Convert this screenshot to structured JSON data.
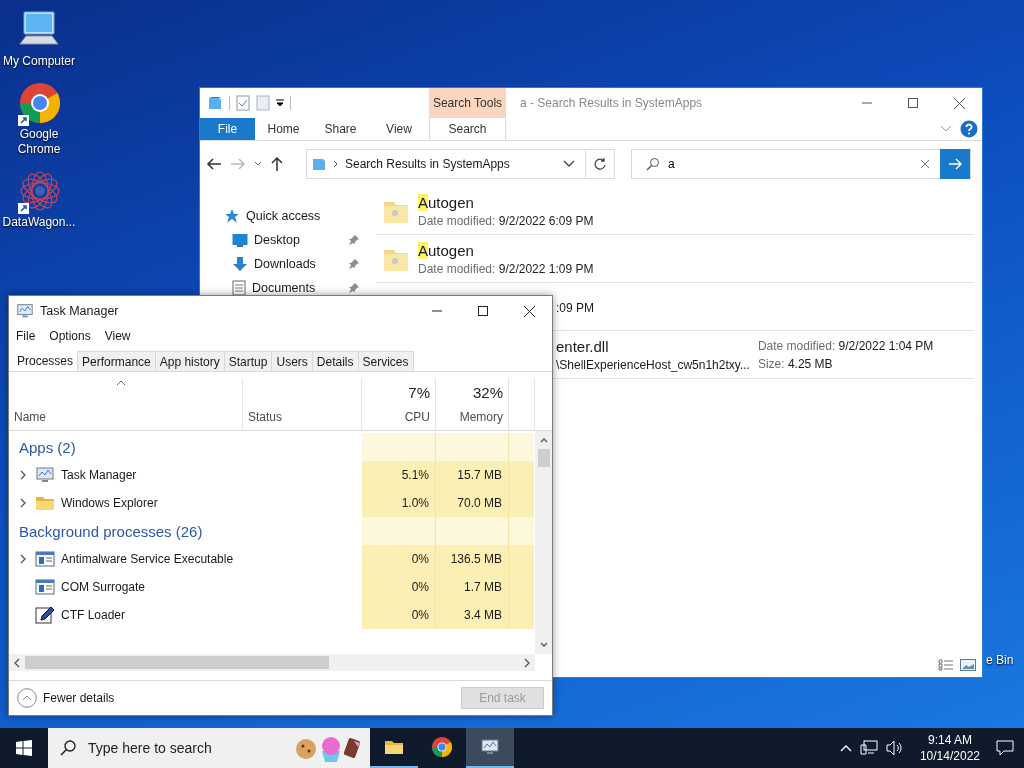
{
  "desktop_icons": [
    {
      "label": "My Computer",
      "kind": "computer"
    },
    {
      "label": "Google Chrome",
      "kind": "chrome"
    },
    {
      "label": "DataWagon...",
      "kind": "mandala"
    }
  ],
  "recycle_bin_label": "e Bin",
  "explorer": {
    "context_tab": "Search Tools",
    "title": "a - Search Results in SystemApps",
    "ribbon_tabs": [
      {
        "label": "File",
        "kind": "file"
      },
      {
        "label": "Home",
        "kind": "tab",
        "selected": false
      },
      {
        "label": "Share",
        "kind": "tab",
        "selected": false
      },
      {
        "label": "View",
        "kind": "tab",
        "selected": false
      },
      {
        "label": "Search",
        "kind": "tab",
        "selected": true
      }
    ],
    "address": "Search Results in SystemApps",
    "search": {
      "value": "a"
    },
    "nav_items": [
      {
        "label": "Quick access",
        "kind": "star",
        "pinned": false
      },
      {
        "label": "Desktop",
        "kind": "desktop",
        "pinned": true
      },
      {
        "label": "Downloads",
        "kind": "download",
        "pinned": true
      },
      {
        "label": "Documents",
        "kind": "document",
        "pinned": true
      }
    ],
    "results": [
      {
        "kind": "folder",
        "name_match": "A",
        "name_rest": "utogen",
        "date_label": "Date modified:",
        "date": "9/2/2022 6:09 PM"
      },
      {
        "kind": "folder",
        "name_match": "A",
        "name_rest": "utogen",
        "date_label": "Date modified:",
        "date": "9/2/2022 1:09 PM"
      },
      {
        "kind": "covered",
        "date": ":09 PM"
      },
      {
        "kind": "covered",
        "name": "enter.dll",
        "path": "\\ShellExperienceHost_cw5n1h2txy...",
        "date_label": "Date modified:",
        "date": "9/2/2022 1:04 PM",
        "size_label": "Size:",
        "size": "4.25 MB"
      }
    ]
  },
  "task_manager": {
    "title": "Task Manager",
    "menu": [
      "File",
      "Options",
      "View"
    ],
    "tabs": [
      {
        "label": "Processes",
        "selected": true
      },
      {
        "label": "Performance",
        "selected": false
      },
      {
        "label": "App history",
        "selected": false
      },
      {
        "label": "Startup",
        "selected": false
      },
      {
        "label": "Users",
        "selected": false
      },
      {
        "label": "Details",
        "selected": false
      },
      {
        "label": "Services",
        "selected": false
      }
    ],
    "columns": {
      "name": "Name",
      "status": "Status",
      "cpu_total": "7%",
      "cpu": "CPU",
      "memory_total": "32%",
      "memory": "Memory"
    },
    "groups": [
      {
        "title": "Apps (2)",
        "rows": [
          {
            "name": "Task Manager",
            "kind": "monitor",
            "expandable": true,
            "cpu": "5.1%",
            "memory": "15.7 MB"
          },
          {
            "name": "Windows Explorer",
            "kind": "folder",
            "expandable": true,
            "cpu": "1.0%",
            "memory": "70.0 MB"
          }
        ]
      },
      {
        "title": "Background processes (26)",
        "rows": [
          {
            "name": "Antimalware Service Executable",
            "kind": "window",
            "expandable": true,
            "cpu": "0%",
            "memory": "136.5 MB"
          },
          {
            "name": "COM Surrogate",
            "kind": "window",
            "expandable": false,
            "cpu": "0%",
            "memory": "1.7 MB"
          },
          {
            "name": "CTF Loader",
            "kind": "pen",
            "expandable": false,
            "cpu": "0%",
            "memory": "3.4 MB"
          }
        ]
      }
    ],
    "fewer_details": "Fewer details",
    "end_task": {
      "label": "End task",
      "disabled": true
    }
  },
  "taskbar": {
    "search_placeholder": "Type here to search",
    "apps": [
      {
        "kind": "folder",
        "running": true,
        "active": false
      },
      {
        "kind": "chrome",
        "running": false,
        "active": false
      },
      {
        "kind": "monitor",
        "running": true,
        "active": true
      }
    ],
    "time": "9:14 AM",
    "date": "10/14/2022"
  }
}
